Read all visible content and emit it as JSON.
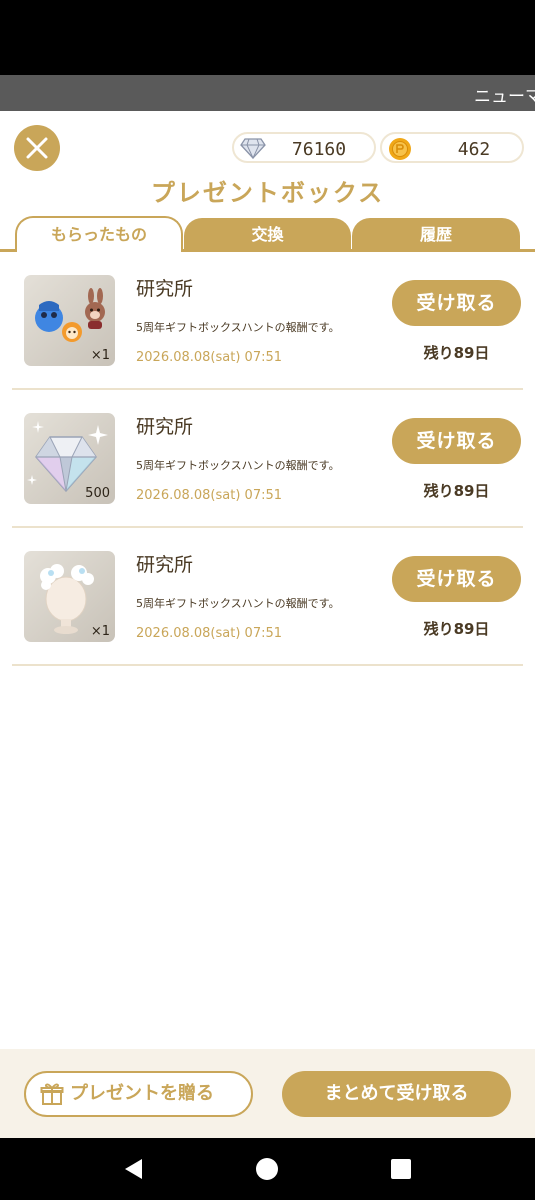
{
  "ticker": {
    "text": "ニューマ"
  },
  "header": {
    "diamond_amount": "76160",
    "coin_amount": "462",
    "title": "プレゼントボックス"
  },
  "tabs": [
    {
      "label": "もらったもの",
      "active": true
    },
    {
      "label": "交換",
      "active": false
    },
    {
      "label": "履歴",
      "active": false
    }
  ],
  "items": [
    {
      "sender": "研究所",
      "message": "5周年ギフトボックスハントの報酬です。",
      "date": "2026.08.08(sat) 07:51",
      "quantity": "×1",
      "button": "受け取る",
      "remaining": "残り89日",
      "icon": "characters-icon"
    },
    {
      "sender": "研究所",
      "message": "5周年ギフトボックスハントの報酬です。",
      "date": "2026.08.08(sat) 07:51",
      "quantity": "500",
      "button": "受け取る",
      "remaining": "残り89日",
      "icon": "diamond-icon"
    },
    {
      "sender": "研究所",
      "message": "5周年ギフトボックスハントの報酬です。",
      "date": "2026.08.08(sat) 07:51",
      "quantity": "×1",
      "button": "受け取る",
      "remaining": "残り89日",
      "icon": "bust-icon"
    }
  ],
  "footer": {
    "gift_label": "プレゼントを贈る",
    "receive_all_label": "まとめて受け取る"
  },
  "colors": {
    "accent": "#c9a659",
    "text": "#4a3a24",
    "footer_bg": "#f7f2e8"
  }
}
